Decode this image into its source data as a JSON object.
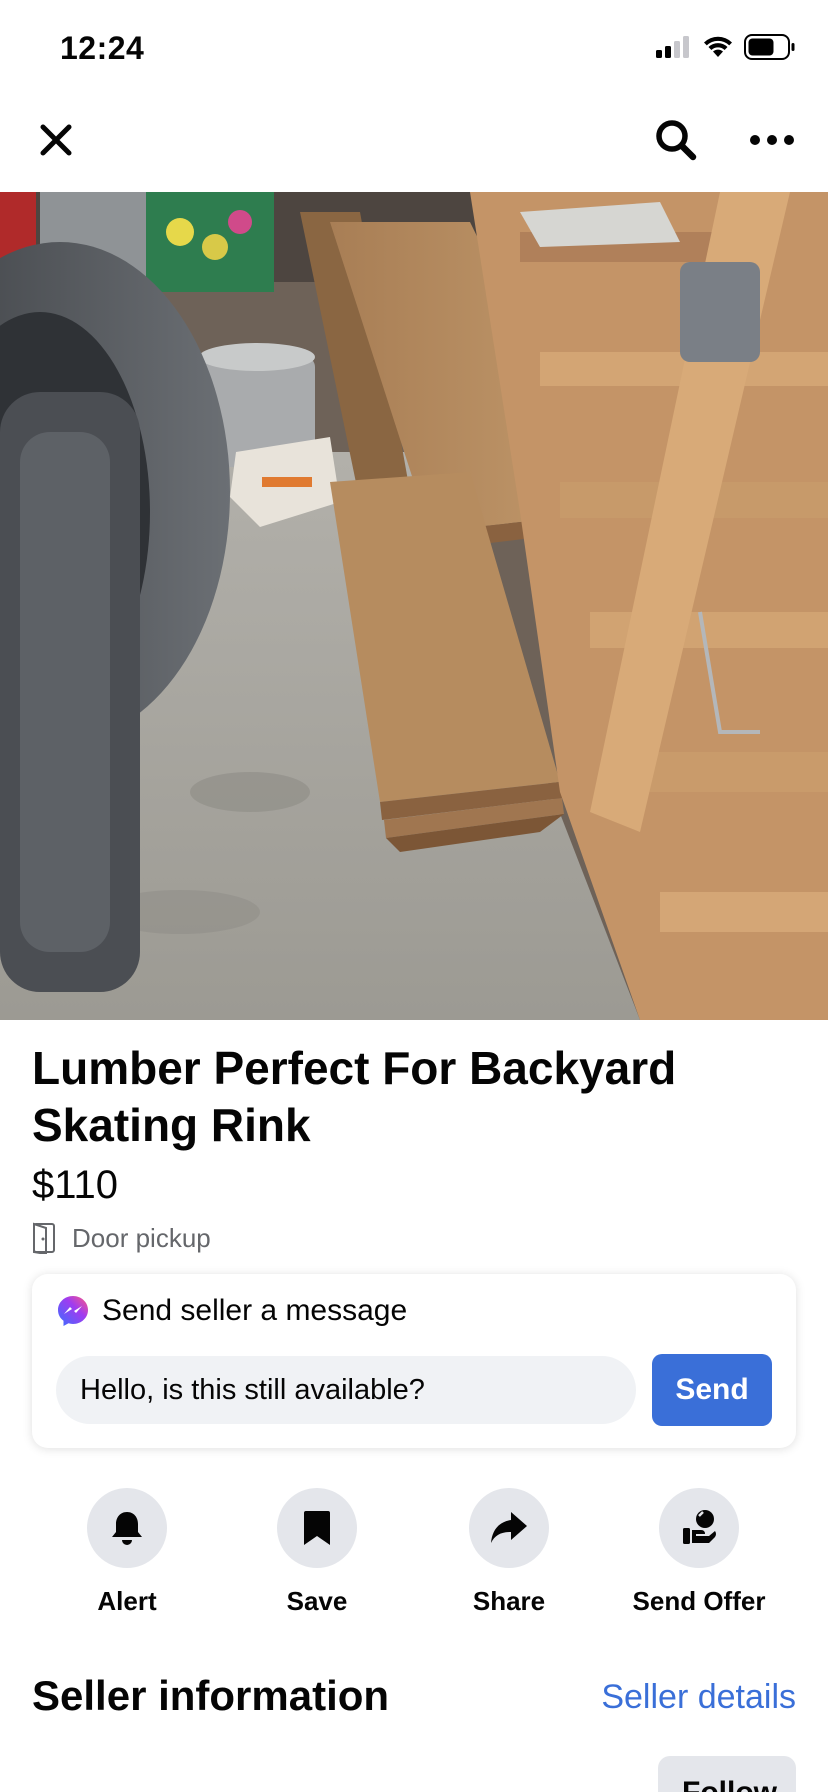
{
  "status": {
    "time": "12:24"
  },
  "nav": {
    "close_icon": "close-icon",
    "search_icon": "search-icon",
    "more_icon": "more-icon"
  },
  "listing": {
    "title": "Lumber Perfect For Backyard Skating Rink",
    "price": "$110",
    "pickup_label": "Door pickup",
    "pickup_icon": "door-icon"
  },
  "message": {
    "heading": "Send seller a message",
    "input_value": "Hello, is this still available?",
    "send_label": "Send",
    "messenger_icon": "messenger-icon"
  },
  "actions": [
    {
      "label": "Alert",
      "icon": "bell-icon"
    },
    {
      "label": "Save",
      "icon": "bookmark-icon"
    },
    {
      "label": "Share",
      "icon": "share-icon"
    },
    {
      "label": "Send Offer",
      "icon": "offer-icon"
    }
  ],
  "seller": {
    "heading": "Seller information",
    "details_link": "Seller details",
    "follow_label": "Follow"
  },
  "colors": {
    "accent": "#3a6fd8",
    "button_bg": "#e4e6eb",
    "input_bg": "#f0f2f5",
    "secondary_text": "#65676b"
  }
}
